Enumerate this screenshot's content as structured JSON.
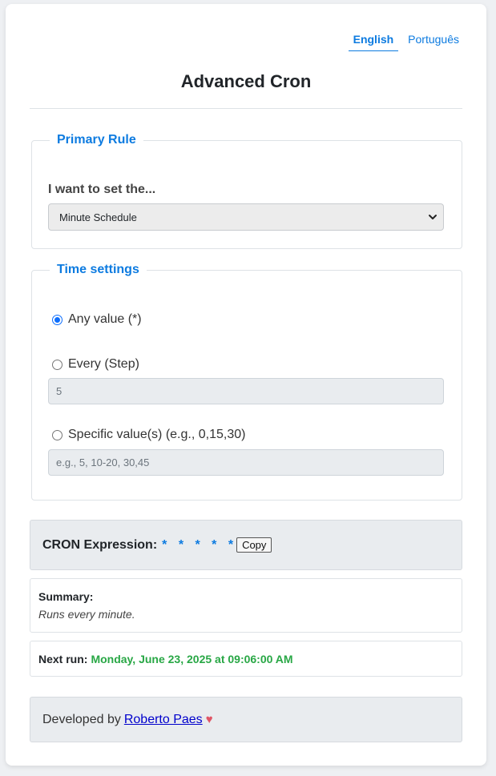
{
  "language": {
    "english": "English",
    "portugues": "Português"
  },
  "title": "Advanced Cron",
  "primary_rule": {
    "legend": "Primary Rule",
    "label": "I want to set the...",
    "selected": "Minute Schedule"
  },
  "time_settings": {
    "legend": "Time settings",
    "any_label": "Any value (*)",
    "step_label": "Every (Step)",
    "step_value": "5",
    "specific_label": "Specific value(s) (e.g., 0,15,30)",
    "specific_placeholder": "e.g., 5, 10-20, 30,45",
    "selected_option": "any"
  },
  "cron": {
    "label": "CRON Expression:",
    "expression": "* * * * *",
    "copy_label": "Copy"
  },
  "summary": {
    "label": "Summary:",
    "text": "Runs every minute."
  },
  "next_run": {
    "label": "Next run:",
    "value": "Monday, June 23, 2025 at 09:06:00 AM"
  },
  "footer": {
    "prefix": "Developed by",
    "author": "Roberto Paes",
    "heart": "♥"
  },
  "colors": {
    "accent": "#0d7be0",
    "success": "#28a745",
    "heart": "#e05565"
  }
}
